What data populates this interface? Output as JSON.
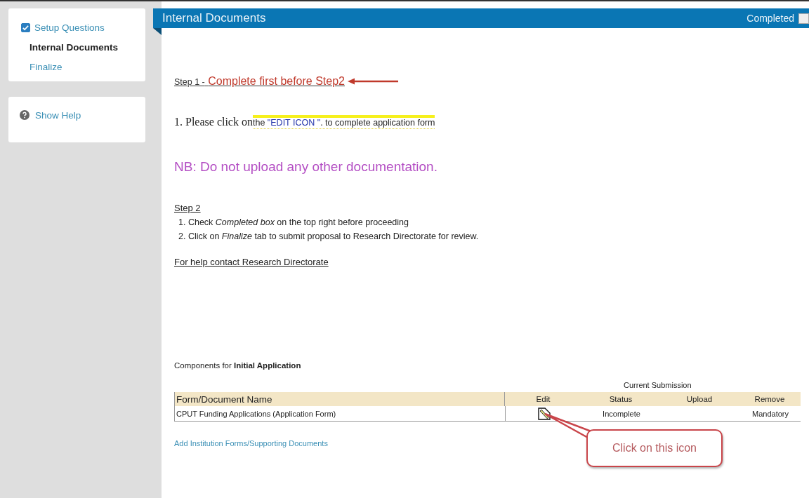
{
  "sidebar": {
    "steps": [
      {
        "label": "Setup Questions",
        "kind": "checkbox",
        "checked": true
      },
      {
        "label": "Internal Documents",
        "kind": "current"
      },
      {
        "label": "Finalize",
        "kind": "link"
      }
    ],
    "help": "Show Help"
  },
  "header": {
    "title": "Internal Documents",
    "completed_label": "Completed",
    "completed_checked": false
  },
  "step1": {
    "label": "Step 1 -",
    "note": "Complete first before Step2"
  },
  "instruction": {
    "lead": "1. Please click on",
    "pre": "the",
    "quoted": "\"EDIT ICON  \"",
    "tail": ". to complete application form"
  },
  "warning": "NB: Do not upload any other documentation.",
  "step2": {
    "label": "Step 2",
    "items": [
      "1. Check  *Completed box* on the top right  before proceeding",
      "2. Click on *Finalize* tab to submit proposal to Research Directorate for review."
    ]
  },
  "help_link": "For help contact Research Directorate",
  "components": {
    "caption": "Components for **Initial Application**",
    "group_header": "Current Submission",
    "columns": [
      "Form/Document Name",
      "Edit",
      "Status",
      "Upload",
      "Remove"
    ],
    "rows": [
      {
        "name": "CPUT Funding Applications (Application Form)",
        "status": "Incomplete",
        "upload": "",
        "remove": "Mandatory"
      }
    ],
    "add_link": "Add Institution Forms/Supporting Documents"
  },
  "callout": "Click on this icon"
}
